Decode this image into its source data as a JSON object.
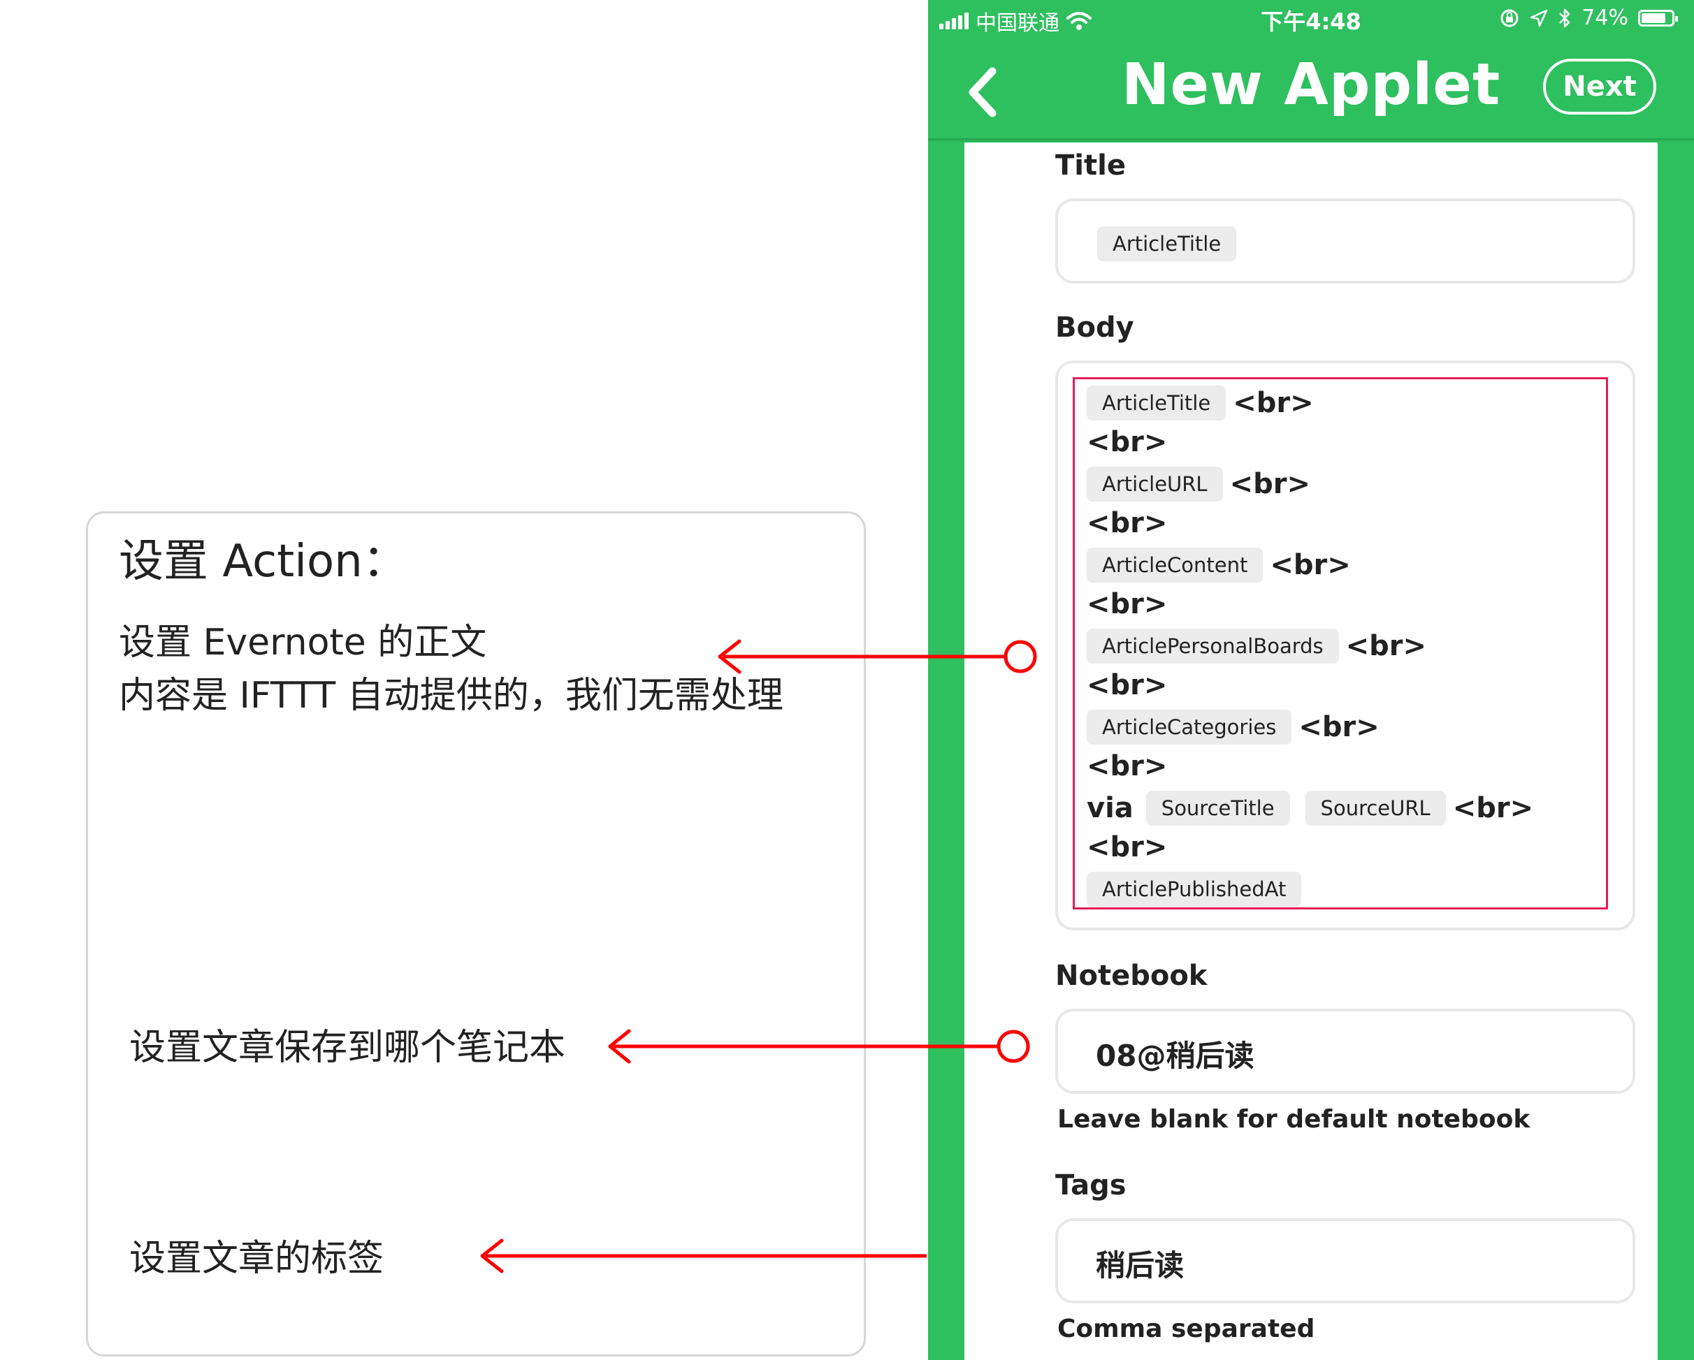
{
  "annotations": {
    "heading": "设置 Action：",
    "body_line_1": "设置 Evernote 的正文",
    "body_line_2": "内容是 IFTTT 自动提供的，我们无需处理",
    "notebook_note": "设置文章保存到哪个笔记本",
    "tags_note": "设置文章的标签",
    "arrow_color": "#ff0000"
  },
  "status_bar": {
    "carrier": "中国联通",
    "time": "下午4:48",
    "battery": "74%",
    "icons": [
      "signal-icon",
      "wifi-icon",
      "lock-rotation-icon",
      "location-icon",
      "bluetooth-icon",
      "battery-icon"
    ]
  },
  "nav": {
    "title": "New Applet",
    "next_label": "Next",
    "back_icon": "chevron-left-icon"
  },
  "form": {
    "title_label": "Title",
    "title_ingredients": [
      "ArticleTitle"
    ],
    "body_label": "Body",
    "body_lines": [
      {
        "ingredient": "ArticleTitle",
        "suffix": "<br>"
      },
      {
        "text": "<br>"
      },
      {
        "ingredient": "ArticleURL",
        "suffix": "<br>"
      },
      {
        "text": "<br>"
      },
      {
        "ingredient": "ArticleContent",
        "suffix": "<br>"
      },
      {
        "text": "<br>"
      },
      {
        "ingredient": "ArticlePersonalBoards",
        "suffix": "<br>"
      },
      {
        "text": "<br>"
      },
      {
        "ingredient": "ArticleCategories",
        "suffix": "<br>"
      },
      {
        "text": "<br>"
      },
      {
        "prefix": "via",
        "ingredients": [
          "SourceTitle",
          "SourceURL"
        ],
        "suffix": "<br>"
      },
      {
        "text": "<br>"
      },
      {
        "ingredient": "ArticlePublishedAt"
      }
    ],
    "notebook_label": "Notebook",
    "notebook_value": "08@稍后读",
    "notebook_help": "Leave blank for default notebook",
    "tags_label": "Tags",
    "tags_value": "稍后读",
    "tags_help": "Comma separated"
  },
  "colors": {
    "ifttt_green": "#2ebf5e",
    "highlight_pink": "#e21f5a",
    "pill_bg": "#ececec"
  }
}
